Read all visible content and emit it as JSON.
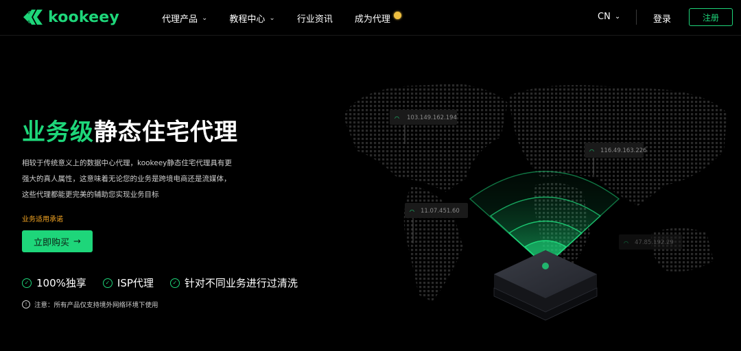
{
  "brand": {
    "name": "kookeey"
  },
  "nav": {
    "items": [
      {
        "label": "代理产品",
        "has_dropdown": true
      },
      {
        "label": "教程中心",
        "has_dropdown": true
      },
      {
        "label": "行业资讯",
        "has_dropdown": false
      },
      {
        "label": "成为代理",
        "has_dropdown": false,
        "badge": "coin-icon"
      }
    ],
    "lang": "CN",
    "login": "登录",
    "register": "注册"
  },
  "hero": {
    "title_highlight": "业务级",
    "title_rest": "静态住宅代理",
    "description": [
      "相较于传统意义上的数据中心代理，kookeey静态住宅代理具有更",
      "强大的真人属性，这意味着无论您的业务是跨境电商还是流媒体，",
      "这些代理都能更完美的辅助您实现业务目标"
    ],
    "promise": "业务适用承诺",
    "buy_button": "立即购买",
    "features": [
      "100%独享",
      "ISP代理",
      "针对不同业务进行过清洗"
    ],
    "note": "注意：所有产品仅支持境外网络环境下使用"
  },
  "map": {
    "ip_tags": [
      "103.149.162.194",
      "116.49.163.226",
      "11.07.451.60",
      "47.85.192.29"
    ]
  },
  "colors": {
    "accent": "#1ed67a",
    "orange": "#f5a623",
    "coin": "#f0c040"
  }
}
